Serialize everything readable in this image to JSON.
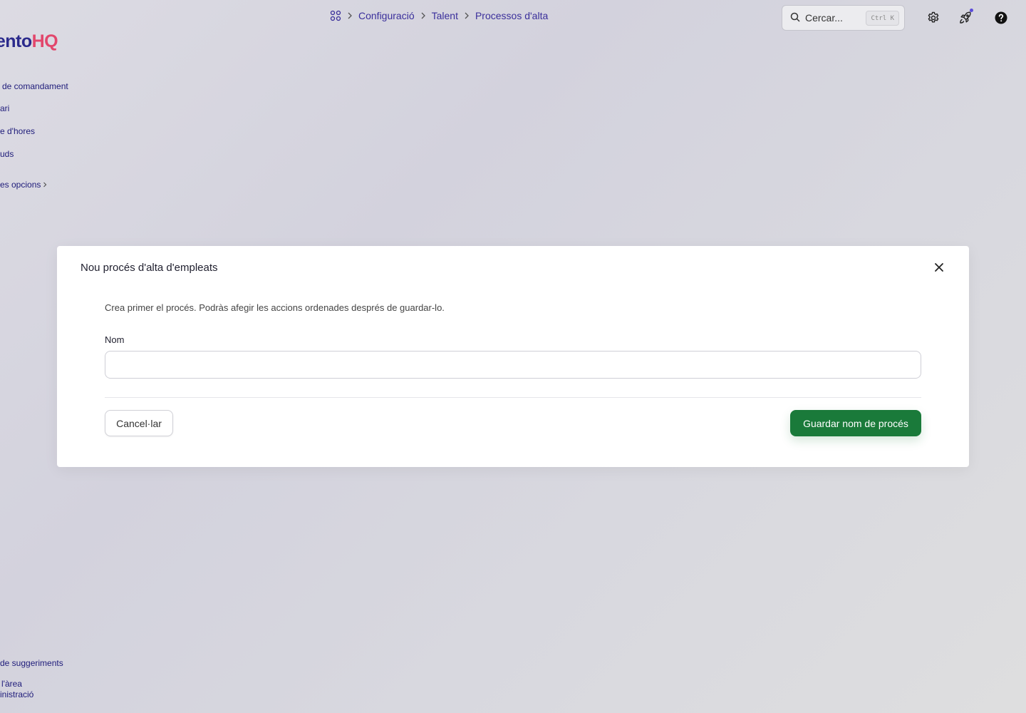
{
  "sidebar": {
    "logo": {
      "part1": "alento",
      "part2": "HQ"
    },
    "items": [
      {
        "label": "de comandament"
      },
      {
        "label": "ari"
      },
      {
        "label": "e d'hores"
      },
      {
        "label": "uds"
      },
      {
        "label": "es opcions"
      }
    ],
    "bottom_items": [
      {
        "label": "de suggeriments"
      },
      {
        "label": "l'àrea"
      },
      {
        "label": "inistració"
      }
    ]
  },
  "breadcrumb": {
    "items": [
      "Configuració",
      "Talent",
      "Processos d'alta"
    ]
  },
  "search": {
    "placeholder": "Cercar...",
    "shortcut": "Ctrl K"
  },
  "modal": {
    "title": "Nou procés d'alta d'empleats",
    "description": "Crea primer el procés. Podràs afegir les accions ordenades després de guardar-lo.",
    "name_label": "Nom",
    "name_value": "",
    "cancel_label": "Cancel·lar",
    "save_label": "Guardar nom de procés"
  },
  "colors": {
    "primary_text": "#2b2a8c",
    "brand_accent": "#e2476c",
    "save_button": "#1a7a3a",
    "notification_dot": "#5b4bdb"
  }
}
